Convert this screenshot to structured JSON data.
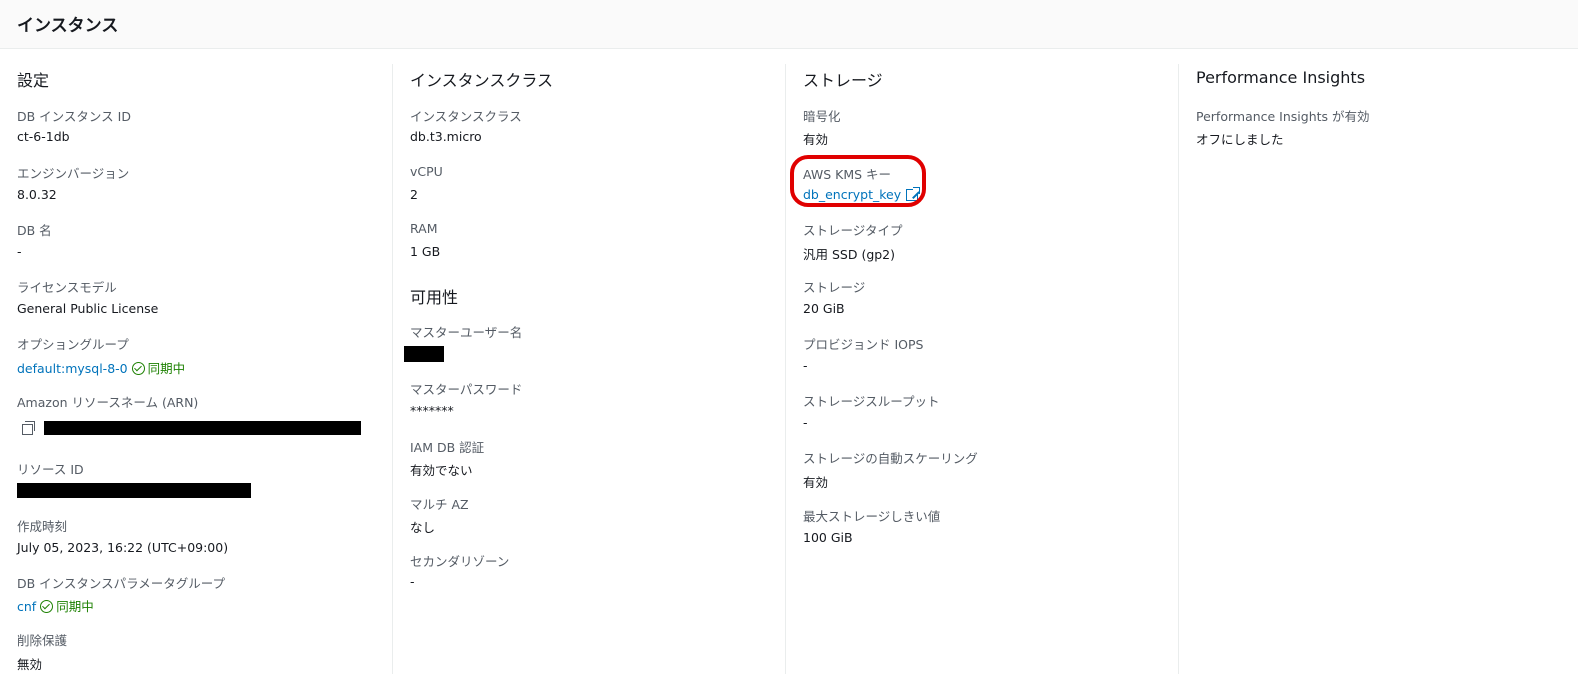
{
  "header": {
    "title": "インスタンス"
  },
  "settings": {
    "title": "設定",
    "db_instance_id": {
      "label": "DB インスタンス ID",
      "value": "ct-6-1db"
    },
    "engine_version": {
      "label": "エンジンバージョン",
      "value": "8.0.32"
    },
    "db_name": {
      "label": "DB 名",
      "value": "-"
    },
    "license_model": {
      "label": "ライセンスモデル",
      "value": "General Public License"
    },
    "option_group": {
      "label": "オプショングループ",
      "value": "default:mysql-8-0",
      "status": "同期中"
    },
    "arn": {
      "label": "Amazon リソースネーム (ARN)"
    },
    "resource_id": {
      "label": "リソース ID"
    },
    "created_time": {
      "label": "作成時刻",
      "value": "July 05, 2023, 16:22 (UTC+09:00)"
    },
    "param_group": {
      "label": "DB インスタンスパラメータグループ",
      "value": "cnf",
      "status": "同期中"
    },
    "deletion_protection": {
      "label": "削除保護",
      "value": "無効"
    }
  },
  "instance_class": {
    "title": "インスタンスクラス",
    "class": {
      "label": "インスタンスクラス",
      "value": "db.t3.micro"
    },
    "vcpu": {
      "label": "vCPU",
      "value": "2"
    },
    "ram": {
      "label": "RAM",
      "value": "1 GB"
    }
  },
  "availability": {
    "title": "可用性",
    "master_user": {
      "label": "マスターユーザー名"
    },
    "master_password": {
      "label": "マスターパスワード",
      "value": "*******"
    },
    "iam_auth": {
      "label": "IAM DB 認証",
      "value": "有効でない"
    },
    "multi_az": {
      "label": "マルチ AZ",
      "value": "なし"
    },
    "secondary_zone": {
      "label": "セカンダリゾーン",
      "value": "-"
    }
  },
  "storage": {
    "title": "ストレージ",
    "encryption": {
      "label": "暗号化",
      "value": "有効"
    },
    "kms_key": {
      "label": "AWS KMS キー",
      "value": "db_encrypt_key"
    },
    "storage_type": {
      "label": "ストレージタイプ",
      "value": "汎用 SSD (gp2)"
    },
    "storage": {
      "label": "ストレージ",
      "value": "20 GiB"
    },
    "iops": {
      "label": "プロビジョンド IOPS",
      "value": "-"
    },
    "throughput": {
      "label": "ストレージスループット",
      "value": "-"
    },
    "autoscaling": {
      "label": "ストレージの自動スケーリング",
      "value": "有効"
    },
    "max_threshold": {
      "label": "最大ストレージしきい値",
      "value": "100 GiB"
    }
  },
  "performance_insights": {
    "title": "Performance Insights",
    "enabled": {
      "label": "Performance Insights が有効",
      "value": "オフにしました"
    }
  },
  "colors": {
    "link": "#0073bb",
    "status_ok": "#1d8102",
    "highlight": "#e00000"
  },
  "icons": [
    "status-ok-icon",
    "copy-icon",
    "external-link-icon"
  ]
}
